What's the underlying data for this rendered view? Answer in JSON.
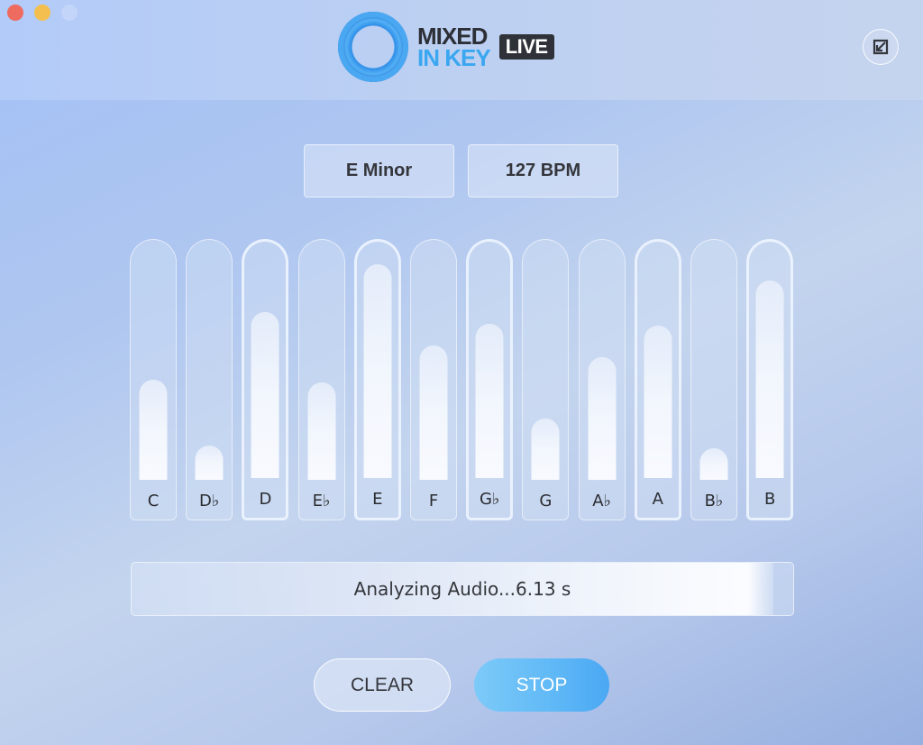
{
  "window": {
    "controls": [
      "close",
      "minimize",
      "maximize"
    ]
  },
  "header": {
    "logo_line1": "MIXED",
    "logo_line2": "IN KEY",
    "logo_badge": "LIVE",
    "mini_mode_icon": "resize-arrow-icon"
  },
  "info": {
    "key": "E Minor",
    "bpm": "127 BPM"
  },
  "chart_data": {
    "type": "bar",
    "title": "",
    "categories": [
      "C",
      "D♭",
      "D",
      "E♭",
      "E",
      "F",
      "G♭",
      "G",
      "A♭",
      "A",
      "B♭",
      "B"
    ],
    "values": [
      0.44,
      0.15,
      0.73,
      0.43,
      0.94,
      0.59,
      0.68,
      0.27,
      0.54,
      0.67,
      0.14,
      0.87
    ],
    "highlighted": [
      false,
      false,
      true,
      false,
      true,
      false,
      true,
      false,
      false,
      true,
      false,
      true
    ],
    "ylim": [
      0,
      1
    ],
    "xlabel": "",
    "ylabel": ""
  },
  "progress": {
    "label": "Analyzing Audio...6.13 s",
    "fraction": 0.97
  },
  "buttons": {
    "clear": "CLEAR",
    "stop": "STOP"
  }
}
